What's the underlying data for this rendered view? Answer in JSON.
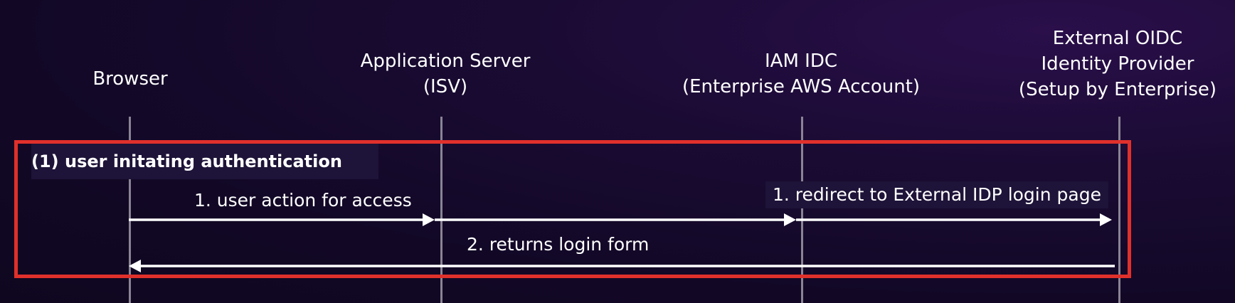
{
  "participants": [
    {
      "id": "browser",
      "lines": [
        "Browser"
      ]
    },
    {
      "id": "app-server",
      "lines": [
        "Application Server",
        "(ISV)"
      ]
    },
    {
      "id": "iam-idc",
      "lines": [
        "IAM IDC",
        "(Enterprise AWS Account)"
      ]
    },
    {
      "id": "external-idp",
      "lines": [
        "External OIDC",
        "Identity Provider",
        "(Setup by Enterprise)"
      ]
    }
  ],
  "frame": {
    "label": "(1) user initating authentication",
    "color": "#e0302b"
  },
  "messages": [
    {
      "label": "1. user action for access",
      "from": "browser",
      "to": "iam-idc"
    },
    {
      "label": "1. redirect to External IDP login page",
      "from": "iam-idc",
      "to": "external-idp"
    },
    {
      "label": "2. returns login form",
      "from": "external-idp",
      "to": "browser"
    }
  ]
}
